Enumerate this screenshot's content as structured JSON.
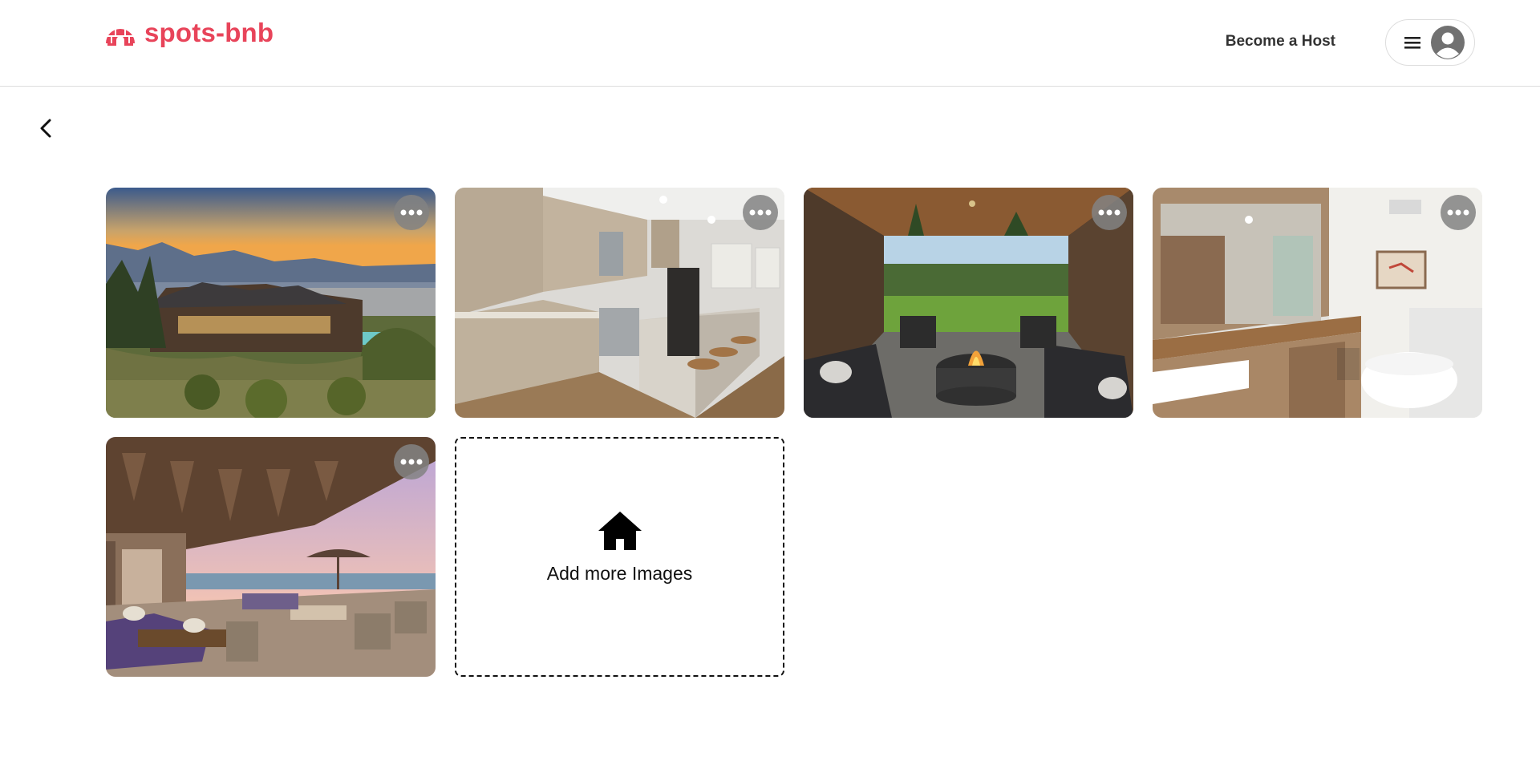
{
  "brand": {
    "name": "spots-bnb",
    "color": "#e8445a",
    "icon": "igloo-icon"
  },
  "header": {
    "become_host_label": "Become a Host",
    "menu_icon": "hamburger-icon",
    "avatar_icon": "user-avatar-icon"
  },
  "navigation": {
    "back_icon": "chevron-left-icon"
  },
  "photos": [
    {
      "subject": "lakeside-lodge-exterior",
      "more_icon": "ellipsis-icon"
    },
    {
      "subject": "kitchen",
      "more_icon": "ellipsis-icon"
    },
    {
      "subject": "covered-patio-fire-pit",
      "more_icon": "ellipsis-icon"
    },
    {
      "subject": "bathroom",
      "more_icon": "ellipsis-icon"
    },
    {
      "subject": "lakeside-terrace",
      "more_icon": "ellipsis-icon"
    }
  ],
  "add_images": {
    "label": "Add more Images",
    "icon": "home-icon"
  }
}
